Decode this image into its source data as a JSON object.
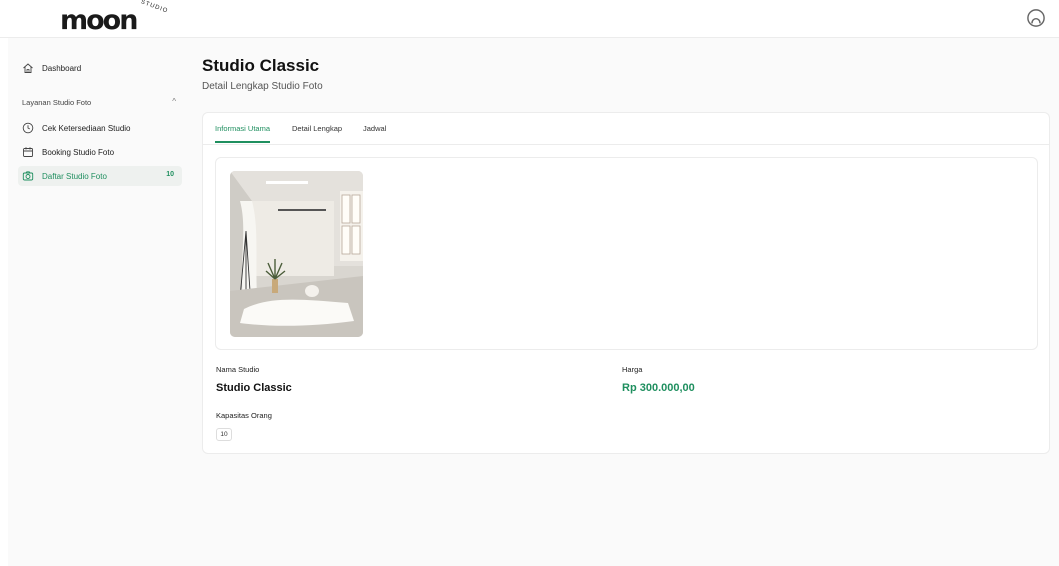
{
  "header": {
    "logo_text": "moon",
    "logo_sub": "STUDIO",
    "avatar_icon": "user-avatar-icon"
  },
  "sidebar": {
    "dashboard": {
      "label": "Dashboard",
      "icon": "home-icon"
    },
    "group": {
      "label": "Layanan Studio Foto",
      "icon": "chevron-up-icon"
    },
    "items": [
      {
        "label": "Cek Ketersediaan Studio",
        "icon": "clock-icon"
      },
      {
        "label": "Booking Studio Foto",
        "icon": "calendar-icon"
      },
      {
        "label": "Daftar Studio Foto",
        "icon": "camera-icon",
        "badge": "10",
        "active": true
      }
    ]
  },
  "page": {
    "title": "Studio Classic",
    "subtitle": "Detail Lengkap Studio Foto"
  },
  "tabs": [
    {
      "label": "Informasi Utama",
      "active": true
    },
    {
      "label": "Detail Lengkap"
    },
    {
      "label": "Jadwal"
    }
  ],
  "details": {
    "name_label": "Nama Studio",
    "name_value": "Studio Classic",
    "price_label": "Harga",
    "price_value": "Rp 300.000,00",
    "capacity_label": "Kapasitas Orang",
    "capacity_value": "10"
  },
  "colors": {
    "accent": "#1f8f5f",
    "background": "#fafafa"
  }
}
